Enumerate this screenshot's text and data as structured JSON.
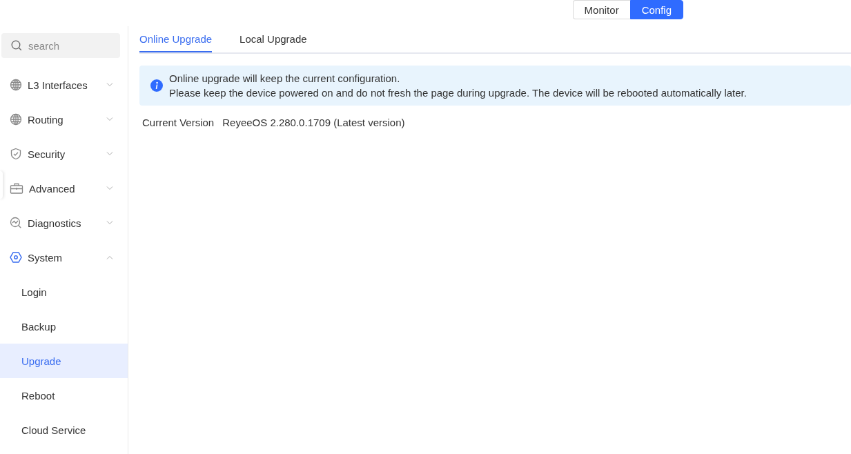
{
  "mode_switch": [
    {
      "label": "Monitor",
      "selected": false
    },
    {
      "label": "Config",
      "selected": true
    }
  ],
  "sidebar": {
    "search": {
      "placeholder": "search"
    },
    "items": [
      {
        "label": "L3 Interfaces",
        "expanded": false
      },
      {
        "label": "Routing",
        "expanded": false
      },
      {
        "label": "Security",
        "expanded": false
      },
      {
        "label": "Advanced",
        "expanded": false
      },
      {
        "label": "Diagnostics",
        "expanded": false
      },
      {
        "label": "System",
        "expanded": true,
        "children": [
          {
            "label": "Login",
            "selected": false
          },
          {
            "label": "Backup",
            "selected": false
          },
          {
            "label": "Upgrade",
            "selected": true
          },
          {
            "label": "Reboot",
            "selected": false
          },
          {
            "label": "Cloud Service",
            "selected": false
          }
        ]
      }
    ]
  },
  "tabs": [
    {
      "label": "Online Upgrade",
      "selected": true
    },
    {
      "label": "Local Upgrade",
      "selected": false
    }
  ],
  "notice": [
    "Online upgrade will keep the current configuration.",
    "Please keep the device powered on and do not fresh the page during upgrade. The device will be rebooted automatically later."
  ],
  "current_version": {
    "label": "Current Version",
    "value": "ReyeeOS 2.280.0.1709 (Latest version)"
  }
}
